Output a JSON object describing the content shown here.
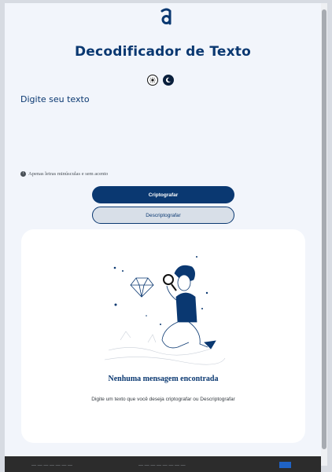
{
  "header": {
    "title": "Decodificador de Texto",
    "logo_icon": "alura-a-logo",
    "theme_toggles": [
      {
        "name": "light-mode",
        "icon": "sun-icon"
      },
      {
        "name": "dark-mode",
        "icon": "moon-icon"
      }
    ]
  },
  "input": {
    "placeholder": "Digite seu texto",
    "value": ""
  },
  "hint": {
    "icon": "info-icon",
    "text": "Apenas letras minúsculas e sem acento"
  },
  "buttons": {
    "encrypt_label": "Criptografar",
    "decrypt_label": "Descriptografar"
  },
  "output": {
    "illustration": "searching-man-with-magnifier-illustration",
    "empty_title": "Nenhuma mensagem encontrada",
    "empty_desc": "Digite um texto que você deseja criptografar ou Descriptografar"
  },
  "colors": {
    "primary": "#0a3871",
    "page_bg": "#f2f5fb",
    "secondary_btn_bg": "#d8dfe8",
    "footer_bg": "#2c2c2c"
  }
}
